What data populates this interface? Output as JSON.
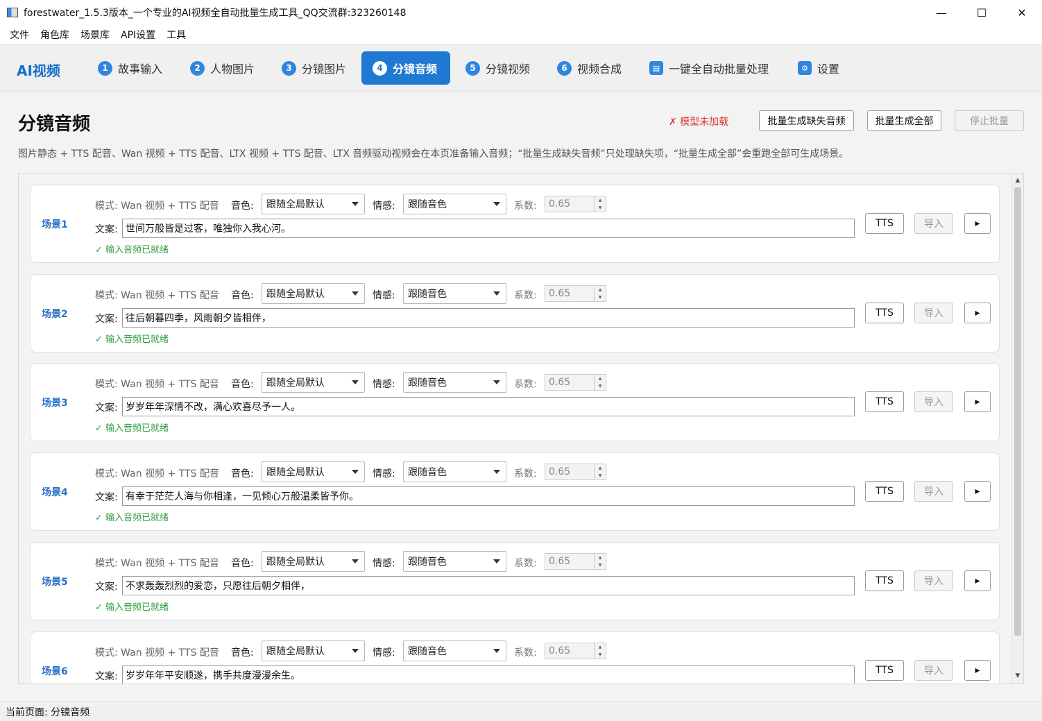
{
  "window": {
    "title": "forestwater_1.5.3版本_一个专业的AI视频全自动批量生成工具_QQ交流群:323260148",
    "controls": [
      "—",
      "☐",
      "✕"
    ]
  },
  "menu": [
    "文件",
    "角色库",
    "场景库",
    "API设置",
    "工具"
  ],
  "brand": "AI视频",
  "tabs": [
    {
      "num": "1",
      "label": "故事输入"
    },
    {
      "num": "2",
      "label": "人物图片"
    },
    {
      "num": "3",
      "label": "分镜图片"
    },
    {
      "num": "4",
      "label": "分镜音频"
    },
    {
      "num": "5",
      "label": "分镜视频"
    },
    {
      "num": "6",
      "label": "视频合成"
    },
    {
      "num": "▤",
      "label": "一键全自动批量处理"
    },
    {
      "num": "⚙",
      "label": "设置"
    }
  ],
  "page": {
    "title": "分镜音频",
    "model_status": "✗ 模型未加载",
    "btn_missing": "批量生成缺失音频",
    "btn_all": "批量生成全部",
    "btn_stop": "停止批量",
    "description": "图片静态 + TTS 配音、Wan 视频 + TTS 配音、LTX 视频 + TTS 配音、LTX 音频驱动视频会在本页准备输入音频；“批量生成缺失音频”只处理缺失项，“批量生成全部”会重跑全部可生成场景。"
  },
  "labels": {
    "mode": "模式: Wan 视频 + TTS 配音",
    "voice": "音色:",
    "emotion": "情感:",
    "coef": "系数:",
    "script": "文案:",
    "tts": "TTS",
    "import": "导入",
    "play": "▸"
  },
  "scenes": [
    {
      "name": "场景1",
      "voice": "跟随全局默认",
      "emotion": "跟随音色",
      "coef": "0.65",
      "text": "世间万般皆是过客，唯独你入我心河。",
      "status": "✓ 输入音频已就绪"
    },
    {
      "name": "场景2",
      "voice": "跟随全局默认",
      "emotion": "跟随音色",
      "coef": "0.65",
      "text": "往后朝暮四季，风雨朝夕皆相伴，",
      "status": "✓ 输入音频已就绪"
    },
    {
      "name": "场景3",
      "voice": "跟随全局默认",
      "emotion": "跟随音色",
      "coef": "0.65",
      "text": "岁岁年年深情不改，满心欢喜尽予一人。",
      "status": "✓ 输入音频已就绪"
    },
    {
      "name": "场景4",
      "voice": "跟随全局默认",
      "emotion": "跟随音色",
      "coef": "0.65",
      "text": "有幸于茫茫人海与你相逢，一见倾心万般温柔皆予你。",
      "status": "✓ 输入音频已就绪"
    },
    {
      "name": "场景5",
      "voice": "跟随全局默认",
      "emotion": "跟随音色",
      "coef": "0.65",
      "text": "不求轰轰烈烈的爱恋，只愿往后朝夕相伴，",
      "status": "✓ 输入音频已就绪"
    },
    {
      "name": "场景6",
      "voice": "跟随全局默认",
      "emotion": "跟随音色",
      "coef": "0.65",
      "text": "岁岁年年平安顺遂，携手共度漫漫余生。",
      "status": ""
    }
  ],
  "statusbar": "当前页面: 分镜音频"
}
